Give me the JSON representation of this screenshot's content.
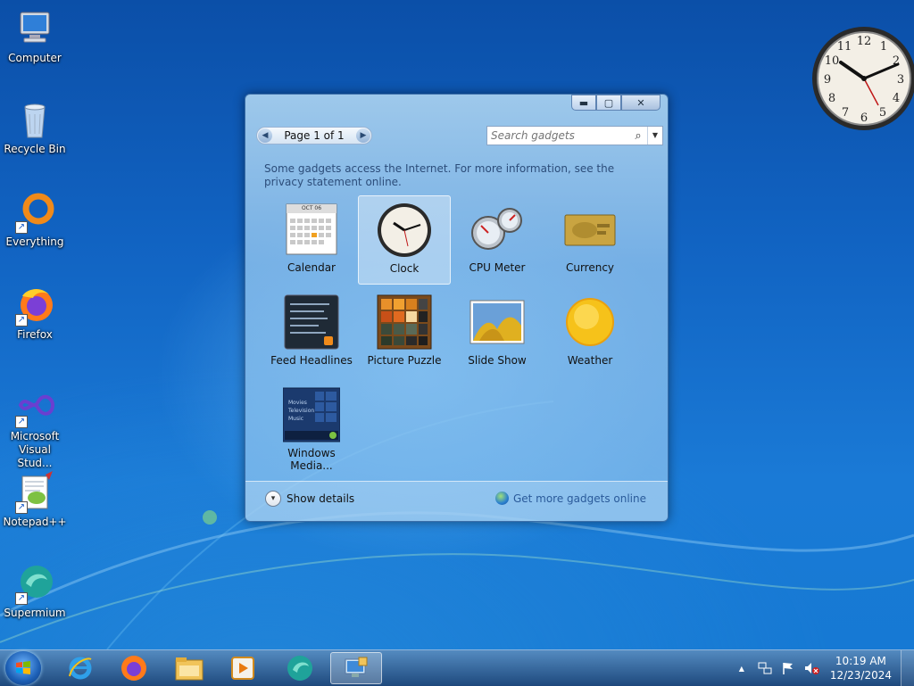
{
  "desktop": {
    "icons": [
      {
        "label": "Computer",
        "icon": "computer-icon"
      },
      {
        "label": "Recycle Bin",
        "icon": "recycle-bin-icon"
      },
      {
        "label": "Everything",
        "icon": "everything-icon"
      },
      {
        "label": "Firefox",
        "icon": "firefox-icon"
      },
      {
        "label": "Microsoft Visual Stud...",
        "icon": "visual-studio-icon"
      },
      {
        "label": "Notepad++",
        "icon": "notepad-plus-plus-icon"
      },
      {
        "label": "Supermium",
        "icon": "supermium-icon"
      }
    ],
    "clock_gadget": {
      "numerals": [
        "12",
        "1",
        "2",
        "3",
        "4",
        "5",
        "6",
        "7",
        "8",
        "9",
        "10",
        "11"
      ]
    }
  },
  "gallery": {
    "window_controls": {
      "minimize": "▬",
      "maximize": "▢",
      "close": "✕"
    },
    "pager": {
      "prev": "◀",
      "text": "Page 1 of 1",
      "next": "▶"
    },
    "search": {
      "placeholder": "Search gadgets",
      "icon": "search-icon",
      "dropdown": "▼"
    },
    "info_text": "Some gadgets access the Internet.  For more information, see the privacy statement online.",
    "gadgets": [
      {
        "label": "Calendar",
        "icon": "calendar-gadget-icon",
        "thumb_text": "OCT 06",
        "selected": false
      },
      {
        "label": "Clock",
        "icon": "clock-gadget-icon",
        "selected": true
      },
      {
        "label": "CPU Meter",
        "icon": "cpu-meter-gadget-icon",
        "selected": false
      },
      {
        "label": "Currency",
        "icon": "currency-gadget-icon",
        "selected": false
      },
      {
        "label": "Feed Headlines",
        "icon": "feed-headlines-gadget-icon",
        "selected": false
      },
      {
        "label": "Picture Puzzle",
        "icon": "picture-puzzle-gadget-icon",
        "selected": false
      },
      {
        "label": "Slide Show",
        "icon": "slide-show-gadget-icon",
        "selected": false
      },
      {
        "label": "Weather",
        "icon": "weather-gadget-icon",
        "selected": false
      },
      {
        "label": "Windows Media...",
        "icon": "windows-media-gadget-icon",
        "thumb_lines": [
          "Movies",
          "Television",
          "Music"
        ],
        "selected": false
      }
    ],
    "show_details": "Show details",
    "show_details_icon": "▾",
    "get_more": "Get more gadgets online"
  },
  "taskbar": {
    "pinned": [
      {
        "name": "internet-explorer-icon"
      },
      {
        "name": "firefox-icon"
      },
      {
        "name": "file-explorer-icon"
      },
      {
        "name": "media-player-icon"
      },
      {
        "name": "supermium-icon"
      },
      {
        "name": "gadgets-icon",
        "active": true
      }
    ],
    "tray": {
      "overflow_arrow": "▲",
      "time": "10:19 AM",
      "date": "12/23/2024"
    }
  }
}
